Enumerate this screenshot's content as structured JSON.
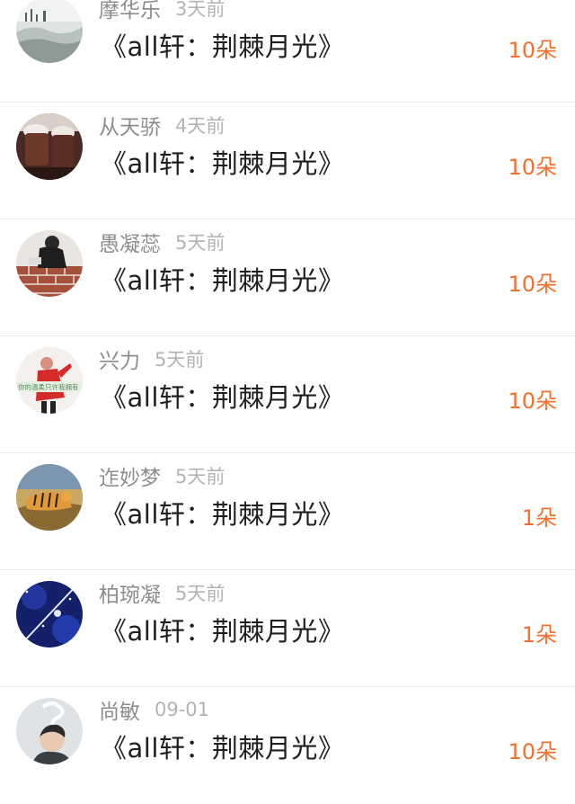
{
  "comments": [
    {
      "username": "摩华乐",
      "time": "3天前",
      "title": "《all轩：荆棘月光》",
      "gift": "10朵",
      "avatar_icon": "misty-landscape-avatar-icon"
    },
    {
      "username": "从天骄",
      "time": "4天前",
      "title": "《all轩：荆棘月光》",
      "gift": "10朵",
      "avatar_icon": "chocolate-drink-avatar-icon"
    },
    {
      "username": "愚凝蕊",
      "time": "5天前",
      "title": "《all轩：荆棘月光》",
      "gift": "10朵",
      "avatar_icon": "brick-wall-avatar-icon"
    },
    {
      "username": "兴力",
      "time": "5天前",
      "title": "《all轩：荆棘月光》",
      "gift": "10朵",
      "avatar_icon": "red-figure-avatar-icon",
      "avatar_text": "你的温柔只许我拥有"
    },
    {
      "username": "迮妙梦",
      "time": "5天前",
      "title": "《all轩：荆棘月光》",
      "gift": "1朵",
      "avatar_icon": "tiger-avatar-icon"
    },
    {
      "username": "柏琬凝",
      "time": "5天前",
      "title": "《all轩：荆棘月光》",
      "gift": "1朵",
      "avatar_icon": "blue-night-avatar-icon"
    },
    {
      "username": "尚敏",
      "time": "09-01",
      "title": "《all轩：荆棘月光》",
      "gift": "10朵",
      "avatar_icon": "boy-smoke-avatar-icon"
    }
  ],
  "colors": {
    "accent": "#f2712f",
    "username": "#8d8d8d",
    "time": "#b3b3b3",
    "title": "#1f1f1f"
  }
}
